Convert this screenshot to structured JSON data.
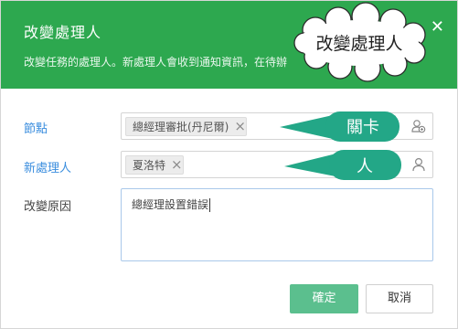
{
  "dialog": {
    "title": "改變處理人",
    "description": "改變任務的處理人。新處理人會收到通知資訊，在待辦",
    "close_icon": "close-icon"
  },
  "form": {
    "node": {
      "label": "節點",
      "tag": "總經理審批(丹尼爾)",
      "icon": "user-group-icon"
    },
    "new_handler": {
      "label": "新處理人",
      "tag": "夏洛特",
      "icon": "user-icon"
    },
    "reason": {
      "label": "改變原因",
      "value": "總經理設置錯誤"
    }
  },
  "buttons": {
    "confirm": "確定",
    "cancel": "取消"
  },
  "annotations": {
    "cloud": "改變處理人",
    "node_callout": "關卡",
    "person_callout": "人"
  },
  "colors": {
    "header": "#2da84f",
    "primary_button": "#5bbf8e",
    "link_label": "#3a8dde",
    "callout": "#23a787"
  }
}
